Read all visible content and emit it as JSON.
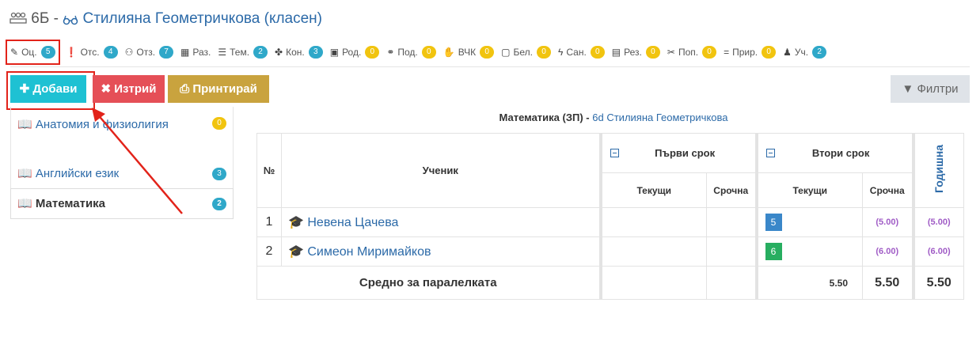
{
  "header": {
    "class_name": "6Б",
    "separator": "-",
    "teacher": "Стилияна Геометричкова (класен)"
  },
  "tabs": [
    {
      "icon": "pencil-icon",
      "label": "Оц.",
      "count": "5",
      "color": "teal"
    },
    {
      "icon": "exclamation-icon",
      "label": "Отс.",
      "count": "4",
      "color": "teal"
    },
    {
      "icon": "users-icon",
      "label": "Отз.",
      "count": "7",
      "color": "teal"
    },
    {
      "icon": "table-icon",
      "label": "Раз.",
      "count": "",
      "color": ""
    },
    {
      "icon": "list-icon",
      "label": "Тем.",
      "count": "2",
      "color": "teal"
    },
    {
      "icon": "puzzle-icon",
      "label": "Кон.",
      "count": "3",
      "color": "teal"
    },
    {
      "icon": "calendar-icon",
      "label": "Род.",
      "count": "0",
      "color": "yellow"
    },
    {
      "icon": "handshake-icon",
      "label": "Под.",
      "count": "0",
      "color": "yellow"
    },
    {
      "icon": "hands-icon",
      "label": "ВЧК",
      "count": "0",
      "color": "yellow"
    },
    {
      "icon": "note-icon",
      "label": "Бел.",
      "count": "0",
      "color": "yellow"
    },
    {
      "icon": "bolt-icon",
      "label": "Сан.",
      "count": "0",
      "color": "yellow"
    },
    {
      "icon": "result-icon",
      "label": "Рез.",
      "count": "0",
      "color": "yellow"
    },
    {
      "icon": "tools-icon",
      "label": "Поп.",
      "count": "0",
      "color": "yellow"
    },
    {
      "icon": "equals-icon",
      "label": "Прир.",
      "count": "0",
      "color": "yellow"
    },
    {
      "icon": "student-icon",
      "label": "Уч.",
      "count": "2",
      "color": "teal"
    }
  ],
  "toolbar": {
    "add_label": "Добави",
    "delete_label": "Изтрий",
    "print_label": "Принтирай",
    "filter_label": "Филтри"
  },
  "subjects": [
    {
      "label": "Анатомия и физиолигия",
      "count": "0",
      "color": "yellow"
    },
    {
      "label": "Английски език",
      "count": "3",
      "color": "teal"
    },
    {
      "label": "Математика",
      "count": "2",
      "color": "teal"
    }
  ],
  "table": {
    "subject": "Математика (ЗП)",
    "separator": "-",
    "teacher": "Стилияна Геометричкова",
    "col_num": "№",
    "col_student": "Ученик",
    "term1": "Първи срок",
    "term2": "Втори срок",
    "current": "Текущи",
    "term_grade": "Срочна",
    "annual": "Годишна",
    "rows": [
      {
        "num": "1",
        "name": "Невена Цачева",
        "t1_current": "",
        "t1_term": "",
        "t2_current": "5",
        "t2_current_color": "blue",
        "t2_term": "(5.00)",
        "annual": "(5.00)"
      },
      {
        "num": "2",
        "name": "Симеон Миримайков",
        "t1_current": "",
        "t1_term": "",
        "t2_current": "6",
        "t2_current_color": "green",
        "t2_term": "(6.00)",
        "annual": "(6.00)"
      }
    ],
    "avg_label": "Средно за паралелката",
    "avg_t2_current": "5.50",
    "avg_t2_term": "5.50",
    "avg_annual": "5.50"
  },
  "colors": {
    "teal": "#2fa8c9",
    "yellow": "#f1c40f",
    "add": "#1ec1d3",
    "delete": "#e54f57",
    "print": "#c9a33e",
    "highlight": "#e2231a"
  }
}
